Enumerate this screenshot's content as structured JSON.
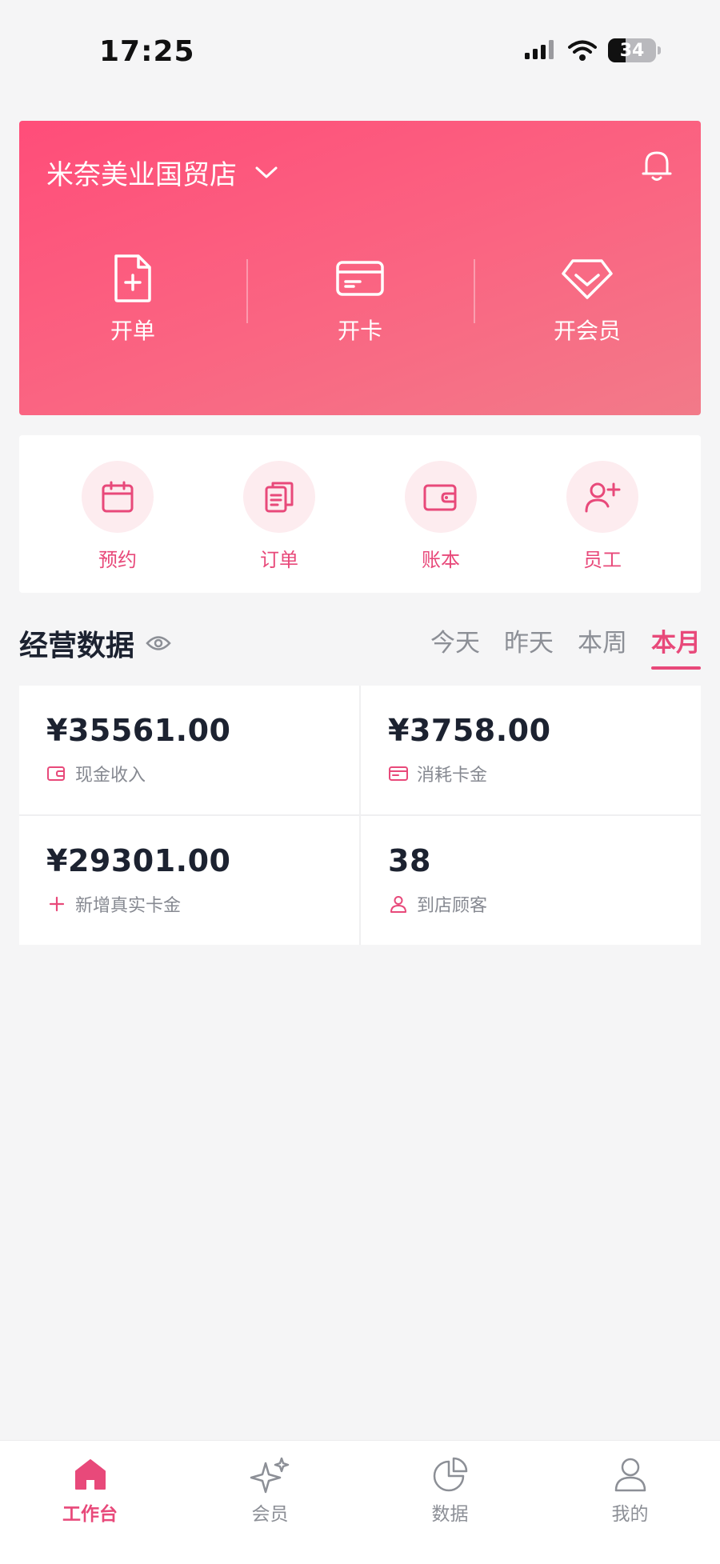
{
  "status_bar": {
    "time": "17:25",
    "battery": "34"
  },
  "header": {
    "store_name": "米奈美业国贸店"
  },
  "hero_actions": [
    {
      "label": "开单",
      "icon": "new-document-icon"
    },
    {
      "label": "开卡",
      "icon": "card-icon"
    },
    {
      "label": "开会员",
      "icon": "diamond-icon"
    }
  ],
  "quick_menu": [
    {
      "label": "预约",
      "icon": "calendar-icon"
    },
    {
      "label": "订单",
      "icon": "clipboard-icon"
    },
    {
      "label": "账本",
      "icon": "wallet-icon"
    },
    {
      "label": "员工",
      "icon": "add-user-icon"
    }
  ],
  "section": {
    "title": "经营数据"
  },
  "tabs": [
    {
      "label": "今天",
      "active": false
    },
    {
      "label": "昨天",
      "active": false
    },
    {
      "label": "本周",
      "active": false
    },
    {
      "label": "本月",
      "active": true
    }
  ],
  "stats": [
    {
      "value": "¥35561.00",
      "label": "现金收入",
      "icon": "wallet-icon"
    },
    {
      "value": "¥3758.00",
      "label": "消耗卡金",
      "icon": "card-icon"
    },
    {
      "value": "¥29301.00",
      "label": "新增真实卡金",
      "icon": "plus-icon"
    },
    {
      "value": "38",
      "label": "到店顾客",
      "icon": "user-icon"
    }
  ],
  "bottom_nav": [
    {
      "label": "工作台",
      "icon": "home-icon",
      "active": true
    },
    {
      "label": "会员",
      "icon": "sparkle-icon",
      "active": false
    },
    {
      "label": "数据",
      "icon": "pie-chart-icon",
      "active": false
    },
    {
      "label": "我的",
      "icon": "profile-icon",
      "active": false
    }
  ],
  "colors": {
    "accent": "#e8497a",
    "hero_start": "#ff4d79",
    "hero_end": "#f27a89",
    "quick_bg": "#fdecef"
  }
}
